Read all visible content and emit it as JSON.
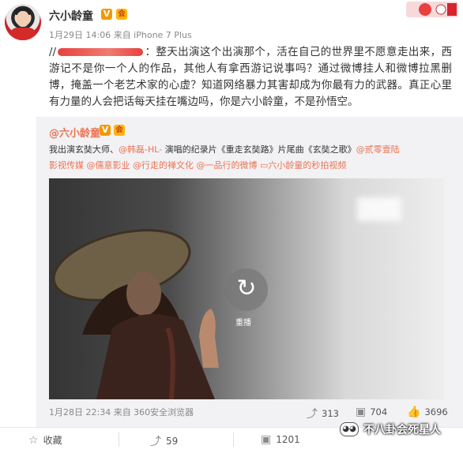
{
  "post": {
    "username": "六小龄童",
    "verified_badge": "V",
    "member_badge": "会",
    "meta": "1月29日 14:06 来自 iPhone 7 Plus",
    "text_prefix": "//",
    "text_body": "：整天出演这个出演那个，活在自己的世界里不愿意走出来，西游记不是你一个人的作品，其他人有拿西游记说事吗？通过微博挂人和微博拉黑删博，掩盖一个老艺术家的心虚？知道网络暴力其害却成为你最有力的武器。真正心里有力量的人会把话每天挂在嘴边吗，你是六小龄童，不是孙悟空。"
  },
  "repost": {
    "username": "@六小龄童",
    "verified_badge": "V",
    "member_badge": "会",
    "line1_start": "我出演玄奘大师、",
    "mention1": "@韩磊-HL-",
    "line1_mid": " 演唱的纪录片《重走玄奘路》片尾曲《玄奘之歌》",
    "mention2": "@贰零壹陆",
    "line2_start": "影视传媒",
    "mention3": "@儒意影业",
    "mention4": "@行走的禅文化",
    "mention5": "@一品行的微博",
    "video_link_icon": "▭",
    "video_link": "六小龄童的秒拍视频",
    "video_replay_label": "重播",
    "date": "1月28日 22:34 来自 360安全浏览器",
    "reposts": "313",
    "comments": "704",
    "likes": "3696"
  },
  "actions": {
    "favorite": "收藏",
    "repost_count": "59",
    "comment_count": "1201"
  },
  "watermark": {
    "text": "不八卦会死星人",
    "icon": "◕◕"
  }
}
